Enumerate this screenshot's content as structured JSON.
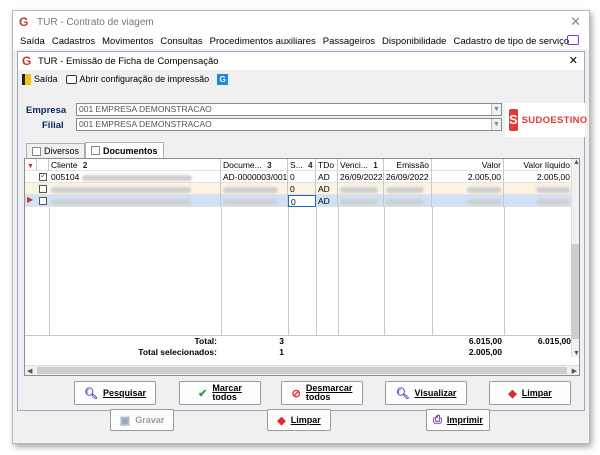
{
  "window": {
    "title": "TUR - Contrato de viagem",
    "close": "✕"
  },
  "menu": [
    "Saída",
    "Cadastros",
    "Movimentos",
    "Consultas",
    "Procedimentos auxiliares",
    "Passageiros",
    "Disponibilidade",
    "Cadastro de tipo de serviço"
  ],
  "child": {
    "title": "TUR - Emissão de Ficha de Compensação",
    "close": "✕"
  },
  "toolbar": {
    "exit_label": "Saída",
    "print_config_label": "Abrir configuração de impressão"
  },
  "fields": {
    "empresa_label": "Empresa",
    "empresa_value": "001 EMPRESA DEMONSTRACAO",
    "filial_label": "Filial",
    "filial_value": "001 EMPRESA DEMONSTRACAO"
  },
  "logo": {
    "letter": "S",
    "text": "SUDOESTINO",
    "color": "#e53935"
  },
  "tabs": [
    "Diversos",
    "Documentos"
  ],
  "grid": {
    "headers": {
      "cliente": "Cliente",
      "cliente_sort": "2",
      "documento": "Docume...",
      "documento_sort": "3",
      "s": "S...",
      "s_sort": "4",
      "tdo": "TDo",
      "vencimento": "Venci...",
      "vencimento_sort": "1",
      "emissao": "Emissão",
      "valor": "Valor",
      "valor_liquido": "Valor líquido"
    },
    "rows": [
      {
        "cliente": "005104",
        "documento": "AD-0000003/001",
        "s": "0",
        "tdo": "AD",
        "vencimento": "26/09/2022",
        "emissao": "26/09/2022",
        "valor": "2.005,00",
        "valor_liquido": "2.005,00"
      },
      {
        "cliente": "",
        "documento": "",
        "s": "0",
        "tdo": "AD",
        "vencimento": "",
        "emissao": "",
        "valor": "",
        "valor_liquido": ""
      },
      {
        "cliente": "",
        "documento": "",
        "s": "0",
        "tdo": "AD",
        "vencimento": "",
        "emissao": "",
        "valor": "",
        "valor_liquido": ""
      }
    ],
    "total_label": "Total:",
    "total_count": "3",
    "total_valor": "6.015,00",
    "total_liquido": "6.015,00",
    "selected_label": "Total selecionados:",
    "selected_count": "1",
    "selected_valor": "2.005,00"
  },
  "buttons": {
    "pesquisar": "Pesquisar",
    "marcar_1": "Marcar",
    "marcar_2": "todos",
    "desmarcar_1": "Desmarcar",
    "desmarcar_2": "todos",
    "visualizar": "Visualizar",
    "limpar": "Limpar",
    "gravar": "Gravar",
    "limpar_bottom": "Limpar",
    "imprimir": "Imprimir"
  },
  "colors": {
    "accent": "#c0392b",
    "selected_row": "#cfe2f7",
    "highlight_row": "#fdf3e2"
  }
}
